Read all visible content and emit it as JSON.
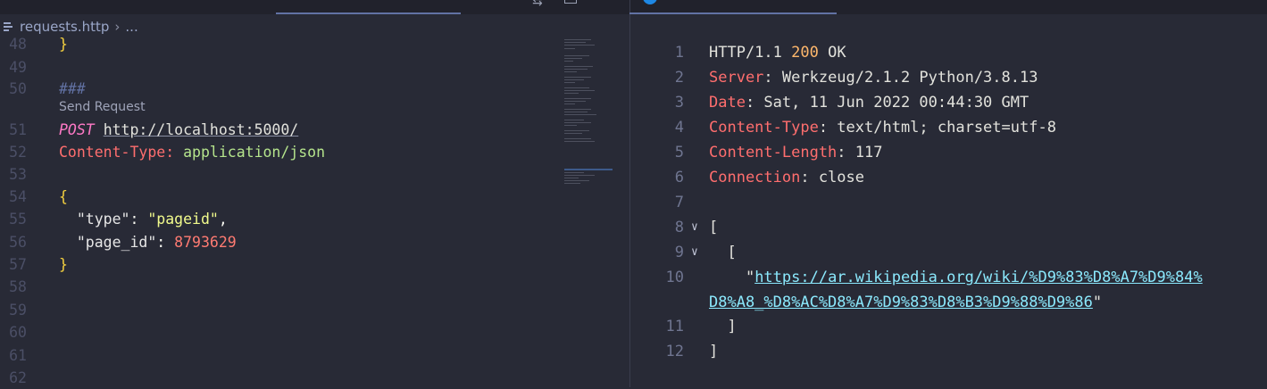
{
  "left": {
    "breadcrumb": {
      "file": "requests.http",
      "separator": "›",
      "more": "..."
    },
    "codelens": "Send Request",
    "lines": [
      {
        "num": "48",
        "tokens": [
          {
            "t": "}",
            "c": "c-bracket"
          }
        ]
      },
      {
        "num": "49",
        "tokens": []
      },
      {
        "num": "50",
        "tokens": [
          {
            "t": "###",
            "c": "c-gray c-italic"
          }
        ]
      },
      {
        "num": "51",
        "tokens": [
          {
            "t": "POST",
            "c": "c-pink c-italic"
          },
          {
            "t": " ",
            "c": "c-default"
          },
          {
            "t": "http://localhost:5000/",
            "c": "c-text c-url"
          }
        ]
      },
      {
        "num": "52",
        "tokens": [
          {
            "t": "Content-Type",
            "c": "c-red"
          },
          {
            "t": ": ",
            "c": "c-red"
          },
          {
            "t": "application/json",
            "c": "c-green"
          }
        ]
      },
      {
        "num": "53",
        "tokens": []
      },
      {
        "num": "54",
        "tokens": [
          {
            "t": "{",
            "c": "c-bracket"
          }
        ]
      },
      {
        "num": "55",
        "tokens": [
          {
            "t": "  \"type\"",
            "c": "c-key"
          },
          {
            "t": ": ",
            "c": "c-default"
          },
          {
            "t": "\"pageid\"",
            "c": "c-yellow"
          },
          {
            "t": ",",
            "c": "c-default"
          }
        ]
      },
      {
        "num": "56",
        "tokens": [
          {
            "t": "  \"page_id\"",
            "c": "c-key"
          },
          {
            "t": ": ",
            "c": "c-default"
          },
          {
            "t": "8793629",
            "c": "c-num"
          }
        ]
      },
      {
        "num": "57",
        "tokens": [
          {
            "t": "}",
            "c": "c-bracket"
          }
        ]
      },
      {
        "num": "58",
        "tokens": []
      },
      {
        "num": "59",
        "tokens": []
      },
      {
        "num": "60",
        "tokens": []
      },
      {
        "num": "61",
        "tokens": []
      },
      {
        "num": "62",
        "tokens": []
      }
    ]
  },
  "right": {
    "lines": [
      {
        "num": "1",
        "fold": "",
        "tokens": [
          {
            "t": "HTTP/1.1 ",
            "c": "c-text"
          },
          {
            "t": "200",
            "c": "c-orange"
          },
          {
            "t": " OK",
            "c": "c-text"
          }
        ]
      },
      {
        "num": "2",
        "fold": "",
        "tokens": [
          {
            "t": "Server",
            "c": "c-hdr"
          },
          {
            "t": ": Werkzeug/2.1.2 Python/3.8.13",
            "c": "c-text"
          }
        ]
      },
      {
        "num": "3",
        "fold": "",
        "tokens": [
          {
            "t": "Date",
            "c": "c-hdr"
          },
          {
            "t": ": Sat, 11 Jun 2022 00:44:30 GMT",
            "c": "c-text"
          }
        ]
      },
      {
        "num": "4",
        "fold": "",
        "tokens": [
          {
            "t": "Content-Type",
            "c": "c-hdr"
          },
          {
            "t": ": text/html; charset=utf-8",
            "c": "c-text"
          }
        ]
      },
      {
        "num": "5",
        "fold": "",
        "tokens": [
          {
            "t": "Content-Length",
            "c": "c-hdr"
          },
          {
            "t": ": 117",
            "c": "c-text"
          }
        ]
      },
      {
        "num": "6",
        "fold": "",
        "tokens": [
          {
            "t": "Connection",
            "c": "c-hdr"
          },
          {
            "t": ": close",
            "c": "c-text"
          }
        ]
      },
      {
        "num": "7",
        "fold": "",
        "tokens": []
      },
      {
        "num": "8",
        "fold": "∨",
        "tokens": [
          {
            "t": "[",
            "c": "c-text"
          }
        ]
      },
      {
        "num": "9",
        "fold": "∨",
        "tokens": [
          {
            "t": "  [",
            "c": "c-text"
          }
        ]
      },
      {
        "num": "10",
        "fold": "",
        "tokens": [
          {
            "t": "    \"",
            "c": "c-text"
          },
          {
            "t": "https://ar.wikipedia.org/wiki/%D9%83%D8%A7%D9%84%",
            "c": "c-link"
          }
        ]
      },
      {
        "num": "",
        "fold": "",
        "tokens": [
          {
            "t": "D8%A8_%D8%AC%D8%A7%D9%83%D8%B3%D9%88%D9%86",
            "c": "c-link"
          },
          {
            "t": "\"",
            "c": "c-text"
          }
        ]
      },
      {
        "num": "11",
        "fold": "",
        "tokens": [
          {
            "t": "  ]",
            "c": "c-text"
          }
        ]
      },
      {
        "num": "12",
        "fold": "",
        "tokens": [
          {
            "t": "]",
            "c": "c-text"
          }
        ]
      }
    ]
  }
}
